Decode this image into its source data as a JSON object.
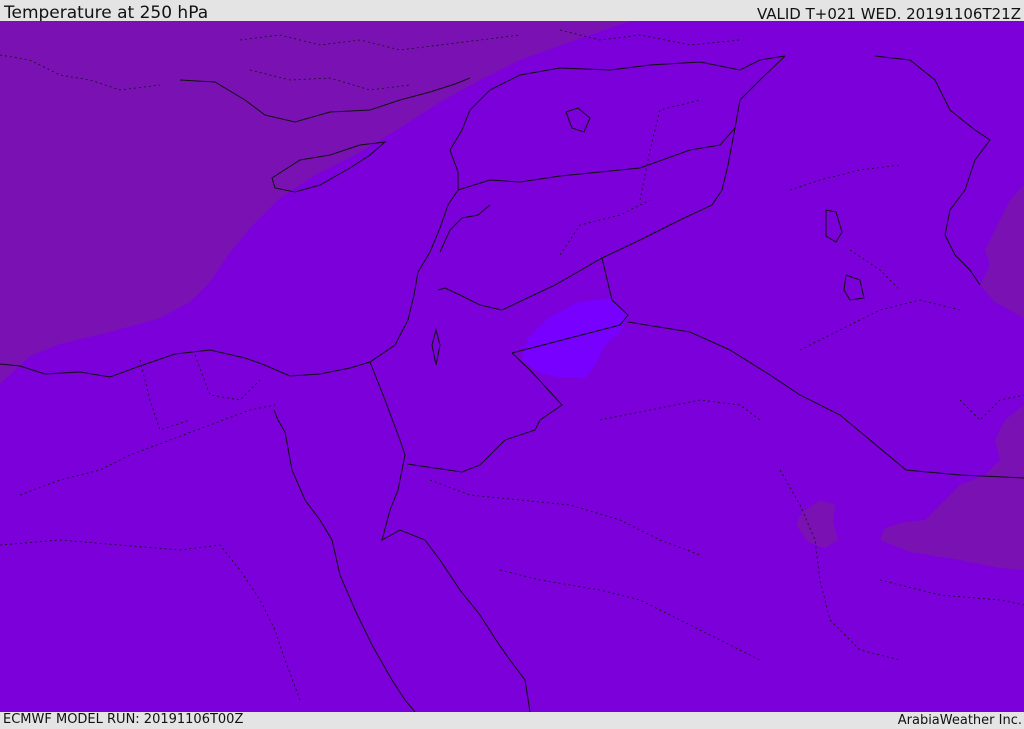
{
  "header": {
    "title": "Temperature at 250 hPa",
    "valid": "VALID T+021 WED. 20191106T21Z"
  },
  "footer": {
    "model_run": "ECMWF MODEL RUN: 20191106T00Z",
    "credit": "ArabiaWeather Inc."
  },
  "map": {
    "field": "temperature",
    "level": "250 hPa",
    "colors": {
      "dominant": "#7b00d9",
      "cold_region": "#7a12b3",
      "warm_region": "#7700ff",
      "border": "#111111"
    }
  }
}
